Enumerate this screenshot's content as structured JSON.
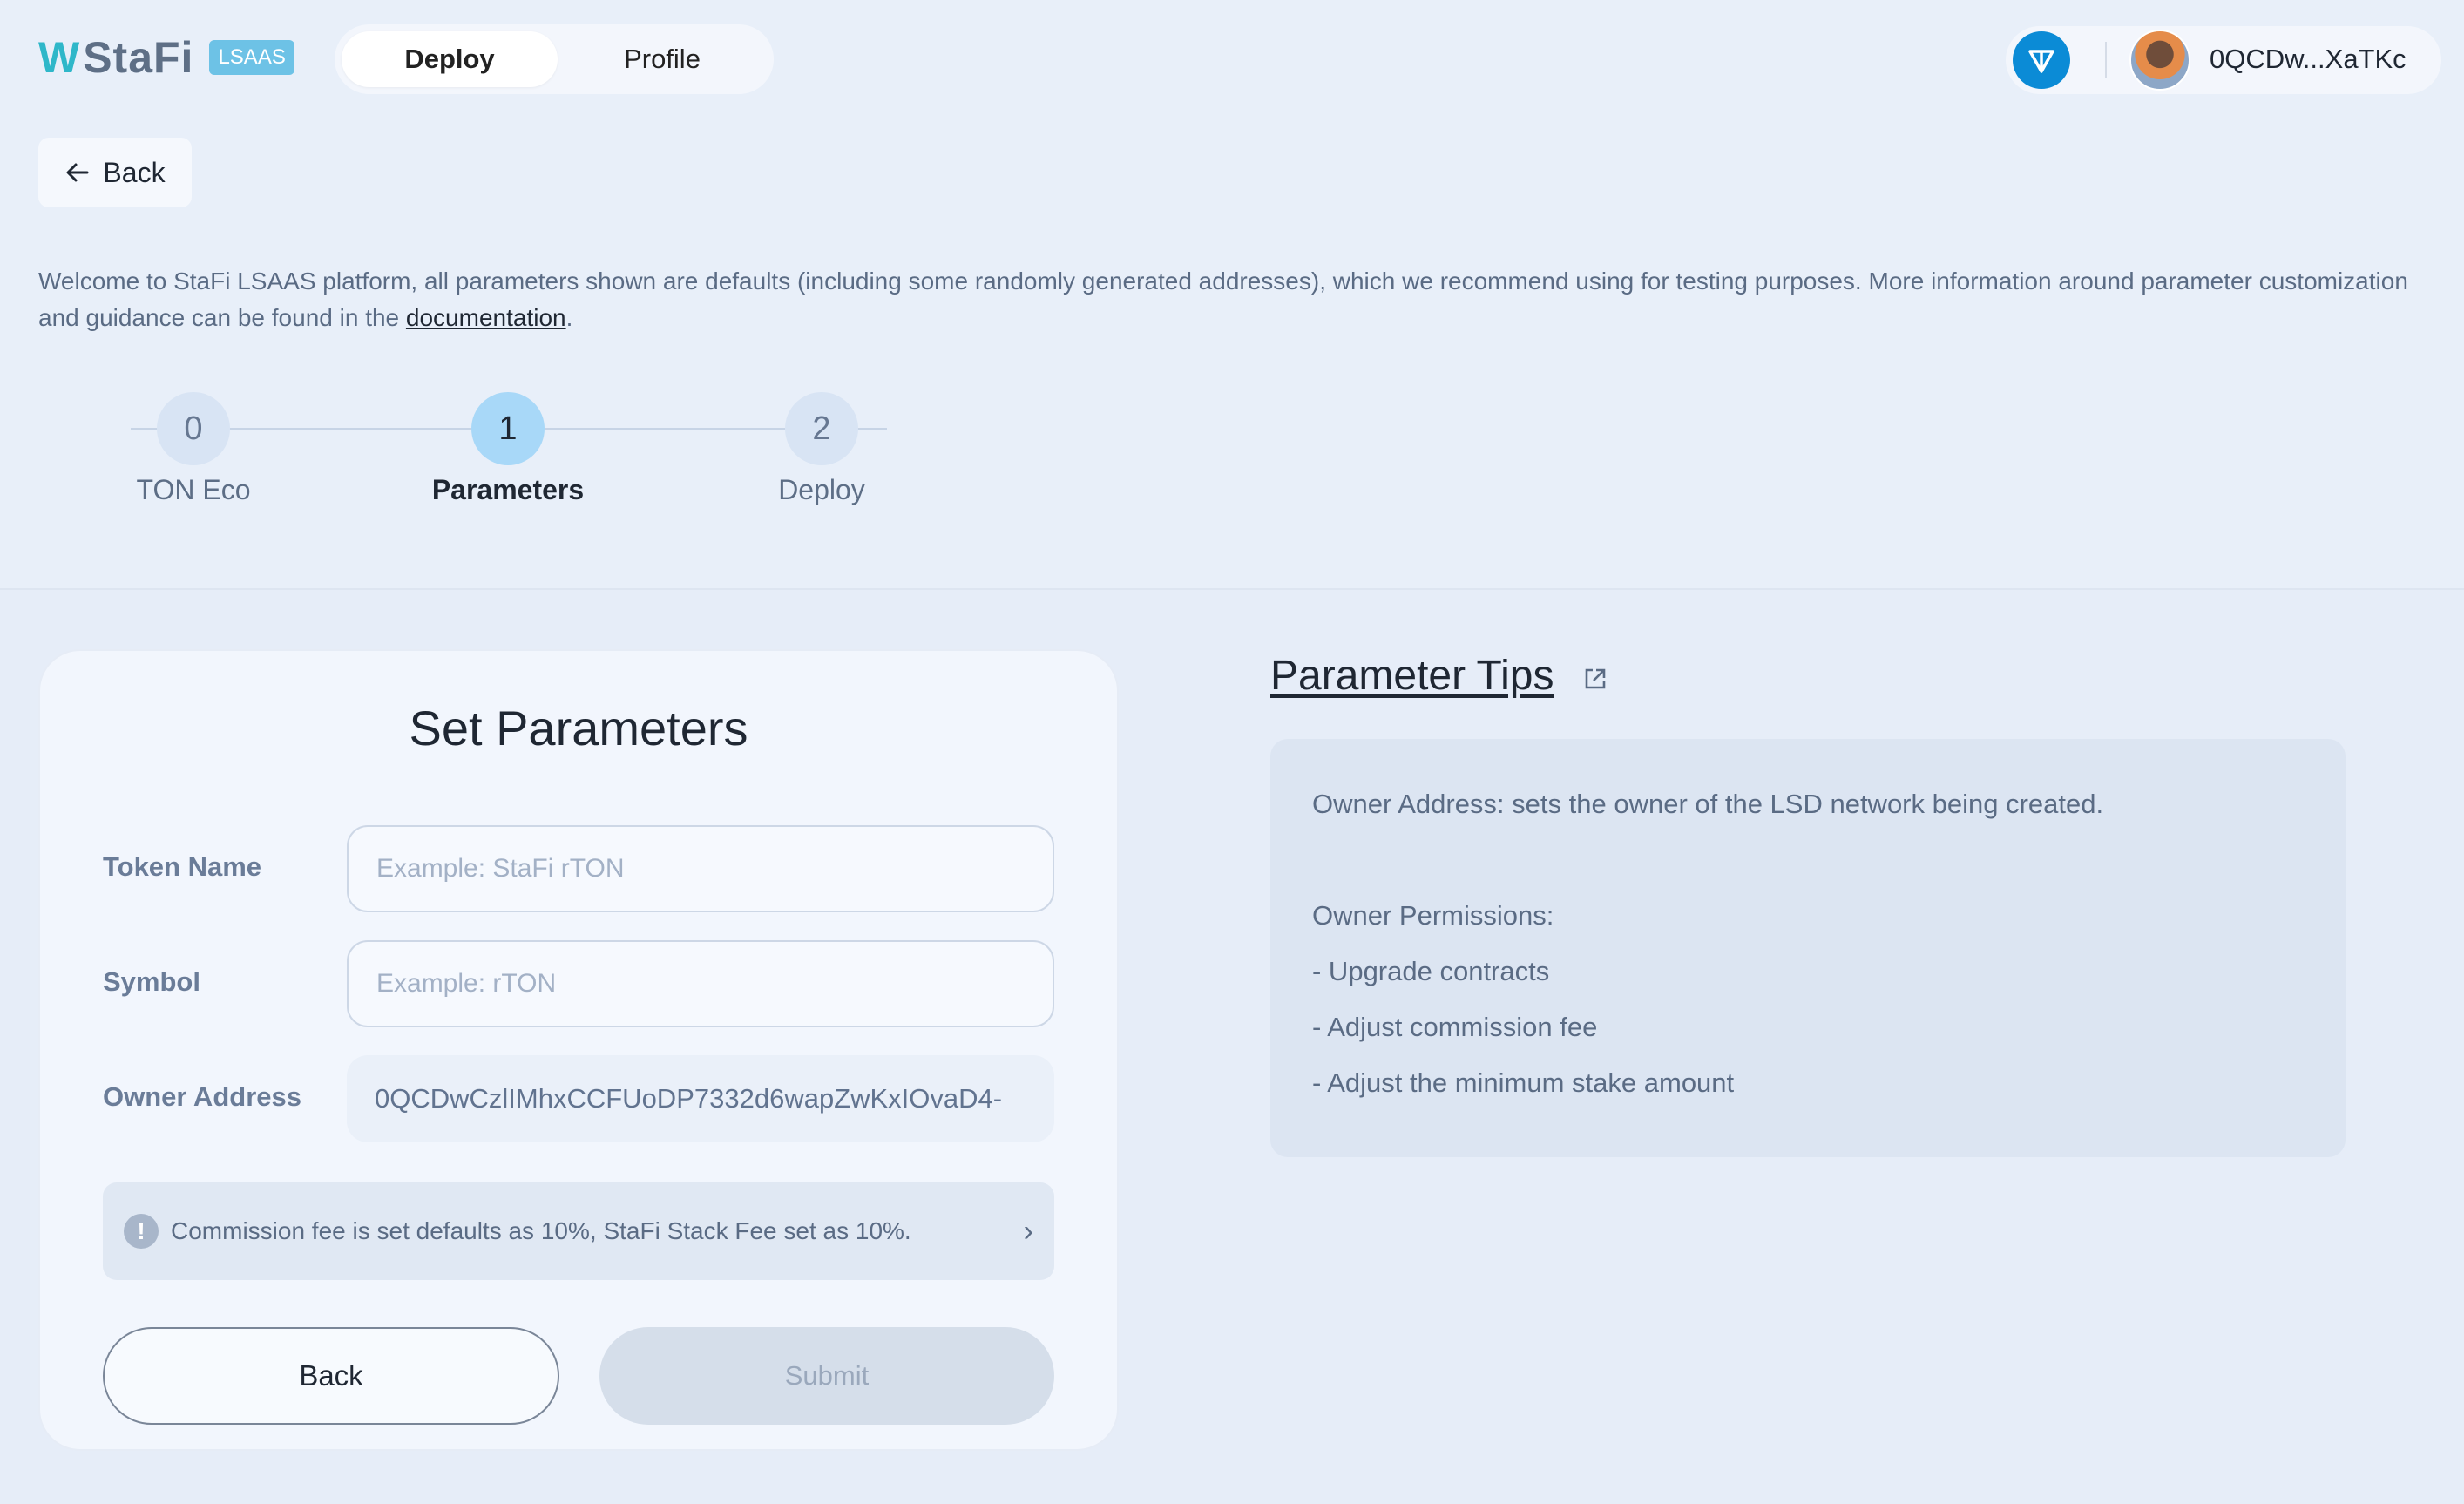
{
  "header": {
    "logo_w": "W",
    "logo_text": "StaFi",
    "logo_badge": "LSAAS",
    "tabs": [
      {
        "label": "Deploy",
        "active": true
      },
      {
        "label": "Profile",
        "active": false
      }
    ],
    "wallet": {
      "network_icon": "ton-icon",
      "address_short": "0QCDw...XaTKc"
    }
  },
  "back_button": {
    "label": "Back",
    "icon": "arrow-left-icon"
  },
  "intro": {
    "text_before": "Welcome to StaFi LSAAS platform, all parameters shown are defaults (including some randomly generated addresses), which we recommend using for testing purposes. More information around parameter customization and guidance can be found in the ",
    "link": "documentation",
    "text_after": "."
  },
  "stepper": {
    "steps": [
      {
        "number": "0",
        "label": "TON Eco"
      },
      {
        "number": "1",
        "label": "Parameters",
        "active": true
      },
      {
        "number": "2",
        "label": "Deploy"
      }
    ]
  },
  "form": {
    "title": "Set Parameters",
    "token_name": {
      "label": "Token Name",
      "value": "",
      "placeholder": "Example: StaFi rTON"
    },
    "symbol": {
      "label": "Symbol",
      "value": "",
      "placeholder": "Example: rTON"
    },
    "owner_address": {
      "label": "Owner Address",
      "value": "0QCDwCzlIMhxCCFUoDP7332d6wapZwKxIOvaD4-"
    },
    "notice": {
      "icon": "!",
      "text": "Commission fee is set defaults as 10%, StaFi Stack Fee set as 10%.",
      "chevron": "›"
    },
    "back_label": "Back",
    "submit_label": "Submit"
  },
  "tips": {
    "title": "Parameter Tips",
    "owner_line": "Owner Address: sets the owner of the LSD network being created.",
    "permissions_title": "Owner Permissions:",
    "permissions": [
      "- Upgrade contracts",
      "- Adjust commission fee",
      "- Adjust the minimum stake amount"
    ]
  },
  "colors": {
    "accent": "#a8d8f8",
    "ton_blue": "#0b8bd6",
    "logo_teal": "#2fb7c9",
    "badge": "#6dc2e6"
  }
}
